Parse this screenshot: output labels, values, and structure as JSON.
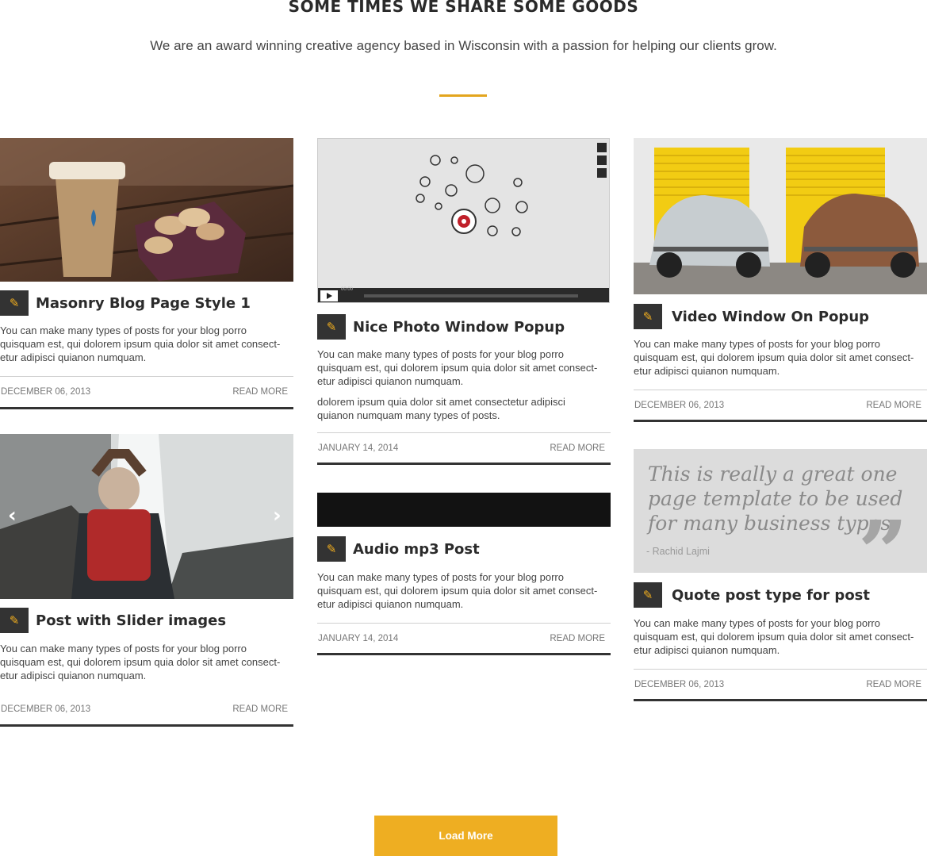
{
  "section": {
    "title": "SOME TIMES WE SHARE SOME GOODS",
    "subtitle": "We are an award winning creative agency based in Wisconsin with a passion for helping our clients grow."
  },
  "posts": [
    {
      "title": "Masonry Blog Page Style 1",
      "text": "You can make many types of posts for your blog porro quisquam est, qui dolorem ipsum quia dolor sit amet consect-etur adipisci quianon numquam.",
      "date": "DECEMBER 06, 2013",
      "read_more": "READ MORE"
    },
    {
      "title": "Post with Slider images",
      "text": "You can make many types of posts for your blog porro quisquam est, qui dolorem ipsum quia dolor sit amet consect-etur adipisci quianon numquam.",
      "date": "DECEMBER 06, 2013",
      "read_more": "READ MORE"
    },
    {
      "title": "Nice Photo Window Popup",
      "text": "You can make many types of posts for your blog porro quisquam est, qui dolorem ipsum quia dolor sit amet consect-etur adipisci quianon numquam.",
      "text2": "dolorem ipsum quia dolor sit amet consectetur adipisci quianon numquam many types of posts.",
      "date": "JANUARY 14, 2014",
      "read_more": "READ MORE"
    },
    {
      "title": "Audio mp3 Post",
      "text": "You can make many types of posts for your blog porro quisquam est, qui dolorem ipsum quia dolor sit amet consect-etur adipisci quianon numquam.",
      "date": "JANUARY 14, 2014",
      "read_more": "READ MORE"
    },
    {
      "title": "Video Window On Popup",
      "text": "You can make many types of posts for your blog porro quisquam est, qui dolorem ipsum quia dolor sit amet consect-etur adipisci quianon numquam.",
      "date": "DECEMBER 06, 2013",
      "read_more": "READ MORE"
    },
    {
      "title": "Quote post type for post",
      "text": "You can make many types of posts for your blog porro quisquam est, qui dolorem ipsum quia dolor sit amet consect-etur adipisci quianon numquam.",
      "date": "DECEMBER 06, 2013",
      "read_more": "READ MORE"
    }
  ],
  "quote": {
    "text": "This is really a great one page template to be used for many business types.",
    "author": "- Rachid Lajmi"
  },
  "video": {
    "time": "00:00"
  },
  "load_more_label": "Load More",
  "colors": {
    "accent": "#eeae22",
    "dark": "#333333"
  },
  "icons": {
    "post": "pencil-icon",
    "slider_prev": "chevron-left-icon",
    "slider_next": "chevron-right-icon",
    "quote": "quote-icon"
  }
}
